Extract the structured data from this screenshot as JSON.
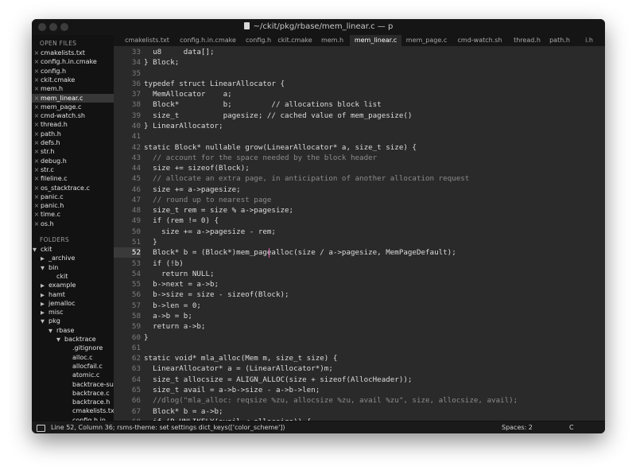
{
  "window": {
    "title": "~/ckit/pkg/rbase/mem_linear.c — p"
  },
  "sidebar": {
    "open_files_header": "OPEN FILES",
    "open_files": [
      {
        "name": "cmakelists.txt",
        "active": false
      },
      {
        "name": "config.h.in.cmake",
        "active": false
      },
      {
        "name": "config.h",
        "active": false
      },
      {
        "name": "ckit.cmake",
        "active": false
      },
      {
        "name": "mem.h",
        "active": false
      },
      {
        "name": "mem_linear.c",
        "active": true
      },
      {
        "name": "mem_page.c",
        "active": false
      },
      {
        "name": "cmd-watch.sh",
        "active": false
      },
      {
        "name": "thread.h",
        "active": false
      },
      {
        "name": "path.h",
        "active": false
      },
      {
        "name": "defs.h",
        "active": false
      },
      {
        "name": "str.h",
        "active": false
      },
      {
        "name": "debug.h",
        "active": false
      },
      {
        "name": "str.c",
        "active": false
      },
      {
        "name": "fileline.c",
        "active": false
      },
      {
        "name": "os_stacktrace.c",
        "active": false
      },
      {
        "name": "panic.c",
        "active": false
      },
      {
        "name": "panic.h",
        "active": false
      },
      {
        "name": "time.c",
        "active": false
      },
      {
        "name": "os.h",
        "active": false
      }
    ],
    "close_glyph": "×",
    "folders_header": "FOLDERS",
    "folders": [
      {
        "name": "ckit",
        "depth": 0,
        "state": "open"
      },
      {
        "name": "_archive",
        "depth": 1,
        "state": "closed"
      },
      {
        "name": "bin",
        "depth": 1,
        "state": "open"
      },
      {
        "name": "ckit",
        "depth": 2,
        "state": "file"
      },
      {
        "name": "example",
        "depth": 1,
        "state": "closed"
      },
      {
        "name": "hamt",
        "depth": 1,
        "state": "closed"
      },
      {
        "name": "jemalloc",
        "depth": 1,
        "state": "closed"
      },
      {
        "name": "misc",
        "depth": 1,
        "state": "closed"
      },
      {
        "name": "pkg",
        "depth": 1,
        "state": "open"
      },
      {
        "name": "rbase",
        "depth": 2,
        "state": "open"
      },
      {
        "name": "backtrace",
        "depth": 3,
        "state": "open"
      },
      {
        "name": ".gitignore",
        "depth": 4,
        "state": "file"
      },
      {
        "name": "alloc.c",
        "depth": 4,
        "state": "file"
      },
      {
        "name": "allocfail.c",
        "depth": 4,
        "state": "file"
      },
      {
        "name": "atomic.c",
        "depth": 4,
        "state": "file"
      },
      {
        "name": "backtrace-supp",
        "depth": 4,
        "state": "file"
      },
      {
        "name": "backtrace.c",
        "depth": 4,
        "state": "file"
      },
      {
        "name": "backtrace.h",
        "depth": 4,
        "state": "file"
      },
      {
        "name": "cmakelists.txt",
        "depth": 4,
        "state": "file"
      },
      {
        "name": "config.h.in",
        "depth": 4,
        "state": "file"
      }
    ]
  },
  "tabs": [
    {
      "label": "cmakelists.txt",
      "active": false
    },
    {
      "label": "config.h.in.cmake",
      "active": false
    },
    {
      "label": "config.h",
      "active": false
    },
    {
      "label": "ckit.cmake",
      "active": false
    },
    {
      "label": "mem.h",
      "active": false
    },
    {
      "label": "mem_linear.c",
      "active": true
    },
    {
      "label": "mem_page.c",
      "active": false
    },
    {
      "label": "cmd-watch.sh",
      "active": false
    },
    {
      "label": "thread.h",
      "active": false
    },
    {
      "label": "path.h",
      "active": false
    },
    {
      "label": "i.h",
      "active": false
    }
  ],
  "editor": {
    "current_line": 52,
    "lines": [
      {
        "n": "33",
        "text": "  u8     data[];",
        "kind": "code"
      },
      {
        "n": "34",
        "text": "} Block;",
        "kind": "code"
      },
      {
        "n": "35",
        "text": "",
        "kind": "code"
      },
      {
        "n": "36",
        "text": "typedef struct LinearAllocator {",
        "kind": "code"
      },
      {
        "n": "37",
        "text": "  MemAllocator    a;",
        "kind": "code"
      },
      {
        "n": "38",
        "text": "  Block*          b;         // allocations block list",
        "kind": "code"
      },
      {
        "n": "39",
        "text": "  size_t          pagesize; // cached value of mem_pagesize()",
        "kind": "code"
      },
      {
        "n": "40",
        "text": "} LinearAllocator;",
        "kind": "code"
      },
      {
        "n": "41",
        "text": "",
        "kind": "code"
      },
      {
        "n": "42",
        "text": "static Block* nullable grow(LinearAllocator* a, size_t size) {",
        "kind": "code"
      },
      {
        "n": "43",
        "text": "  // account for the space needed by the block header",
        "kind": "comment"
      },
      {
        "n": "44",
        "text": "  size += sizeof(Block);",
        "kind": "code"
      },
      {
        "n": "45",
        "text": "  // allocate an extra page, in anticipation of another allocation request",
        "kind": "comment"
      },
      {
        "n": "46",
        "text": "  size += a->pagesize;",
        "kind": "code"
      },
      {
        "n": "47",
        "text": "  // round up to nearest page",
        "kind": "comment"
      },
      {
        "n": "48",
        "text": "  size_t rem = size % a->pagesize;",
        "kind": "code"
      },
      {
        "n": "49",
        "text": "  if (rem != 0) {",
        "kind": "code"
      },
      {
        "n": "50",
        "text": "    size += a->pagesize - rem;",
        "kind": "code"
      },
      {
        "n": "51",
        "text": "  }",
        "kind": "code"
      },
      {
        "n": "52",
        "text": "  Block* b = (Block*)mem_pagealloc(size / a->pagesize, MemPageDefault);",
        "kind": "code"
      },
      {
        "n": "53",
        "text": "  if (!b)",
        "kind": "code"
      },
      {
        "n": "54",
        "text": "    return NULL;",
        "kind": "code"
      },
      {
        "n": "55",
        "text": "  b->next = a->b;",
        "kind": "code"
      },
      {
        "n": "56",
        "text": "  b->size = size - sizeof(Block);",
        "kind": "code"
      },
      {
        "n": "57",
        "text": "  b->len = 0;",
        "kind": "code"
      },
      {
        "n": "58",
        "text": "  a->b = b;",
        "kind": "code"
      },
      {
        "n": "59",
        "text": "  return a->b;",
        "kind": "code"
      },
      {
        "n": "60",
        "text": "}",
        "kind": "code"
      },
      {
        "n": "61",
        "text": "",
        "kind": "code"
      },
      {
        "n": "62",
        "text": "static void* mla_alloc(Mem m, size_t size) {",
        "kind": "code"
      },
      {
        "n": "63",
        "text": "  LinearAllocator* a = (LinearAllocator*)m;",
        "kind": "code"
      },
      {
        "n": "64",
        "text": "  size_t allocsize = ALIGN_ALLOC(size + sizeof(AllocHeader));",
        "kind": "code"
      },
      {
        "n": "65",
        "text": "  size_t avail = a->b->size - a->b->len;",
        "kind": "code"
      },
      {
        "n": "66",
        "text": "  //dlog(\"mla_alloc: reqsize %zu, allocsize %zu, avail %zu\", size, allocsize, avail);",
        "kind": "comment"
      },
      {
        "n": "67",
        "text": "  Block* b = a->b;",
        "kind": "code"
      },
      {
        "n": "68",
        "text": "  if (R_UNLIKELY(avail < allocsize)) {",
        "kind": "code"
      }
    ]
  },
  "statusbar": {
    "text": "Line 52, Column 36; rsms-theme: set settings dict_keys(['color_scheme'])",
    "indent": "Spaces: 2",
    "syntax": "C"
  },
  "colors": {
    "caret": "#e05fb0",
    "editor_bg": "#2a2a2a",
    "sidebar_bg": "#121212"
  }
}
